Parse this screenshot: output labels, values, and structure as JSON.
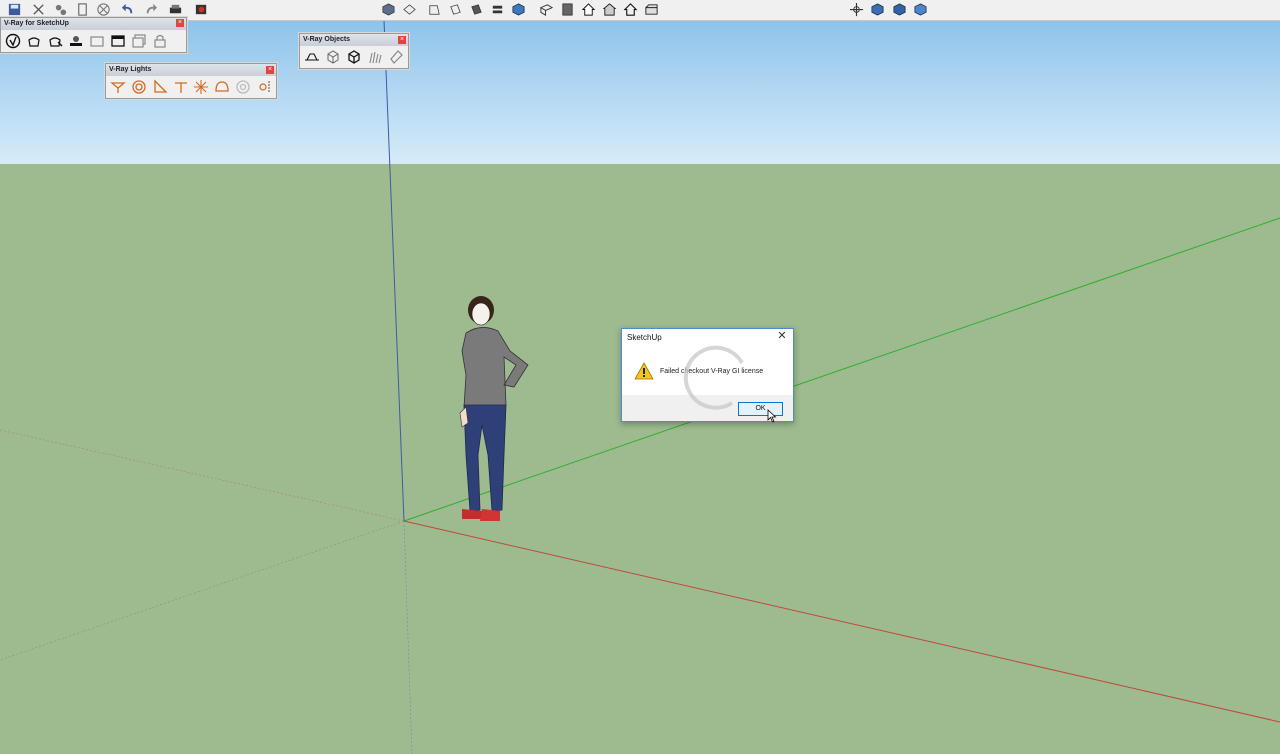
{
  "toolbar": {
    "icons": [
      "save-icon",
      "cut-icon",
      "paint-icon",
      "clipboard-icon",
      "erase-icon",
      "undo-icon",
      "redo-icon",
      "print-icon",
      "render-icon",
      "iso-view-icon",
      "top-view-icon",
      "front-view-icon",
      "right-view-icon",
      "back-view-icon",
      "left-view-icon",
      "xray-style-icon",
      "wireframe-style-icon",
      "hidden-line-icon",
      "shaded-style-icon",
      "textured-style-icon",
      "orbit-icon",
      "pan-icon",
      "zoom-icon",
      "zoom-window-icon"
    ]
  },
  "panels": {
    "vray_main": {
      "title": "V-Ray for SketchUp"
    },
    "vray_lights": {
      "title": "V-Ray Lights"
    },
    "vray_objects": {
      "title": "V-Ray Objects"
    }
  },
  "dialog": {
    "title": "SketchUp",
    "message": "Failed   checkout V-Ray GI  license",
    "ok_label": "OK",
    "close_glyph": "✕"
  }
}
